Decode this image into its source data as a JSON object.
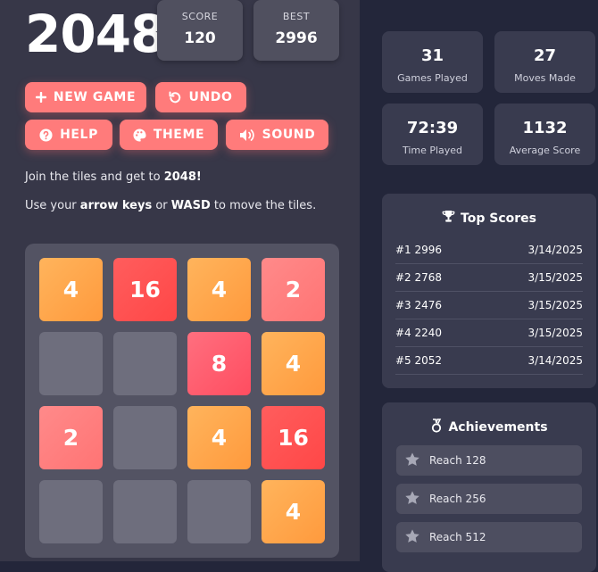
{
  "header": {
    "title": "2048"
  },
  "score": {
    "label": "SCORE",
    "value": "120"
  },
  "best": {
    "label": "BEST",
    "value": "2996"
  },
  "buttons": {
    "new_game": "NEW GAME",
    "undo": "UNDO",
    "help": "HELP",
    "theme": "THEME",
    "sound": "SOUND"
  },
  "instructions": {
    "line1_pre": "Join the tiles and get to ",
    "line1_bold": "2048!",
    "line2_pre": "Use your ",
    "line2_bold1": "arrow keys",
    "line2_mid": " or ",
    "line2_bold2": "WASD",
    "line2_post": " to move the tiles."
  },
  "board": {
    "tiles": [
      [
        "4",
        "16",
        "4",
        "2"
      ],
      [
        "",
        "",
        "8",
        "4"
      ],
      [
        "2",
        "",
        "4",
        "16"
      ],
      [
        "",
        "",
        "",
        "4"
      ]
    ]
  },
  "colors": {
    "2": "#ff7f7f",
    "4": "#ffa64d",
    "8": "#ff5b6b",
    "16": "#ff5555",
    "empty": "#6e6e7d",
    "accent": "#ff7b7b"
  },
  "stats": {
    "games_played": {
      "value": "31",
      "label": "Games Played"
    },
    "moves_made": {
      "value": "27",
      "label": "Moves Made"
    },
    "time_played": {
      "value": "72:39",
      "label": "Time Played"
    },
    "average_score": {
      "value": "1132",
      "label": "Average Score"
    }
  },
  "top_scores": {
    "title": "Top Scores",
    "icon": "trophy-icon",
    "rows": [
      {
        "rank": "#1 2996",
        "date": "3/14/2025"
      },
      {
        "rank": "#2 2768",
        "date": "3/15/2025"
      },
      {
        "rank": "#3 2476",
        "date": "3/15/2025"
      },
      {
        "rank": "#4 2240",
        "date": "3/15/2025"
      },
      {
        "rank": "#5 2052",
        "date": "3/14/2025"
      }
    ]
  },
  "achievements": {
    "title": "Achievements",
    "icon": "medal-icon",
    "items": [
      {
        "label": "Reach 128",
        "icon": "star-icon"
      },
      {
        "label": "Reach 256",
        "icon": "star-icon"
      },
      {
        "label": "Reach 512",
        "icon": "star-icon"
      }
    ]
  }
}
